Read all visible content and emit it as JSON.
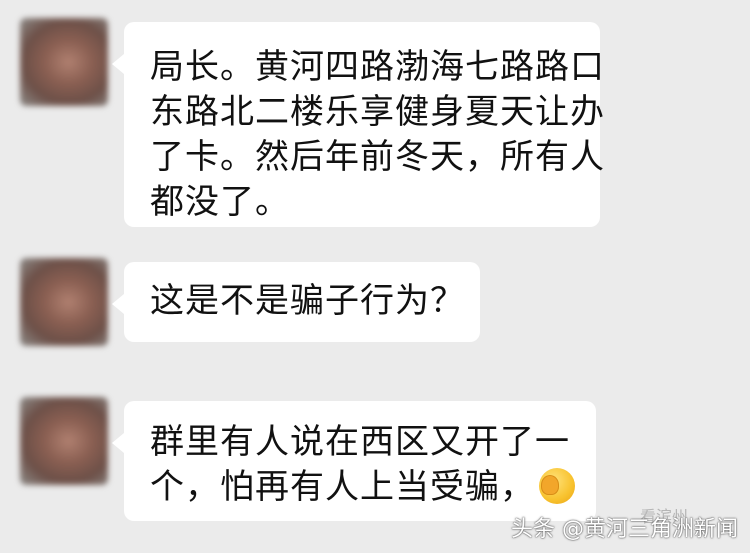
{
  "messages": [
    {
      "lines": [
        "局长。黄河四路渤海七路路口",
        "东路北二楼乐享健身夏天让办",
        "了卡。然后年前冬天，所有人",
        "都没了。"
      ]
    },
    {
      "lines": [
        "这是不是骗子行为？"
      ]
    },
    {
      "lines": [
        "群里有人说在西区又开了一",
        "个，怕再有人上当受骗，"
      ],
      "emoji": "face-palm-emoji"
    }
  ],
  "watermark": {
    "text": "头条 @黄河三角洲新闻",
    "faint_text": "看滨州"
  },
  "colors": {
    "background": "#ebebeb",
    "bubble": "#ffffff",
    "text": "#111111"
  }
}
